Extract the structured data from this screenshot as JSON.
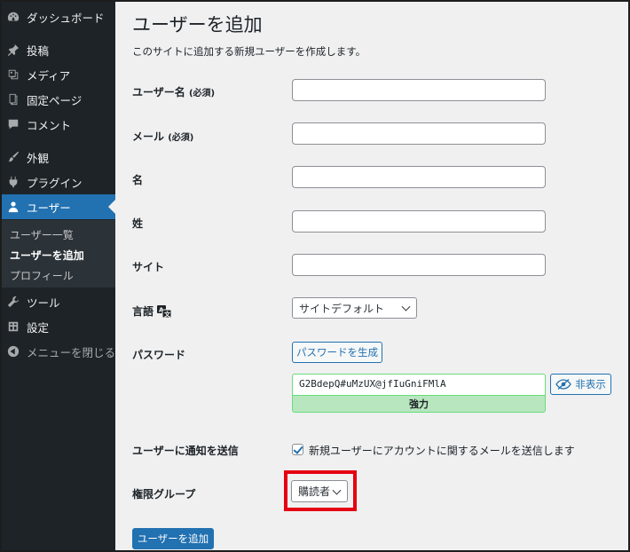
{
  "sidebar": {
    "items": [
      {
        "label": "ダッシュボード",
        "icon": "dashboard-icon"
      },
      {
        "label": "投稿",
        "icon": "pin-icon"
      },
      {
        "label": "メディア",
        "icon": "media-icon"
      },
      {
        "label": "固定ページ",
        "icon": "page-icon"
      },
      {
        "label": "コメント",
        "icon": "comment-icon"
      },
      {
        "label": "外観",
        "icon": "brush-icon"
      },
      {
        "label": "プラグイン",
        "icon": "plugin-icon"
      },
      {
        "label": "ユーザー",
        "icon": "user-icon"
      },
      {
        "label": "ツール",
        "icon": "wrench-icon"
      },
      {
        "label": "設定",
        "icon": "settings-icon"
      },
      {
        "label": "メニューを閉じる",
        "icon": "collapse-icon"
      }
    ],
    "submenu": [
      "ユーザー一覧",
      "ユーザーを追加",
      "プロフィール"
    ]
  },
  "main": {
    "title": "ユーザーを追加",
    "description": "このサイトに追加する新規ユーザーを作成します。",
    "fields": {
      "username_label": "ユーザー名",
      "username_required": "(必須)",
      "email_label": "メール",
      "email_required": "(必須)",
      "first_name_label": "名",
      "last_name_label": "姓",
      "website_label": "サイト",
      "language_label": "言語",
      "language_value": "サイトデフォルト",
      "password_label": "パスワード",
      "generate_password_button": "パスワードを生成",
      "password_value": "G2BdepQ#uMzUX@jfIuGniFMlA",
      "hide_button": "非表示",
      "strength": "強力",
      "notify_label": "ユーザーに通知を送信",
      "notify_text": "新規ユーザーにアカウントに関するメールを送信します",
      "role_label": "権限グループ",
      "role_value": "購読者"
    },
    "submit_button": "ユーザーを追加"
  },
  "colors": {
    "sidebar_bg": "#1d2327",
    "accent": "#2271b1",
    "highlight": "#e50012",
    "strength_bg": "#b8e6bf"
  }
}
